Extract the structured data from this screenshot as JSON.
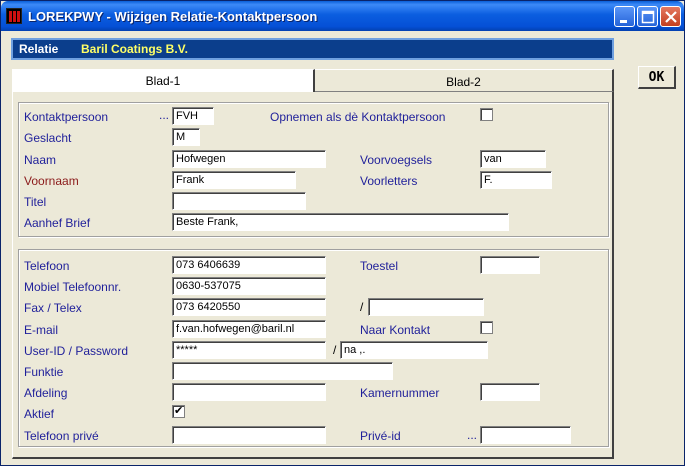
{
  "window": {
    "title": "LOREKPWY - Wijzigen Relatie-Kontaktpersoon",
    "icon": "app-icon",
    "controls": [
      "minimize-icon",
      "maximize-icon",
      "close-icon"
    ]
  },
  "banner": {
    "label": "Relatie",
    "value": "Baril Coatings B.V.",
    "label_color": "#ffffff",
    "value_color": "#ffff66",
    "bg": "#0b3e8c"
  },
  "tabs": [
    {
      "label": "Blad-1",
      "active": true
    },
    {
      "label": "Blad-2",
      "active": false
    }
  ],
  "ok_button": {
    "label": "OK"
  },
  "group1": {
    "kontaktpersoon": {
      "label": "Kontaktpersoon",
      "dots": "...",
      "value": "FVH"
    },
    "opnemen": {
      "label": "Opnemen als dè Kontaktpersoon",
      "checked": false
    },
    "geslacht": {
      "label": "Geslacht",
      "value": "M"
    },
    "naam": {
      "label": "Naam",
      "value": "Hofwegen"
    },
    "voorvoegsels": {
      "label": "Voorvoegsels",
      "value": "van"
    },
    "voornaam": {
      "label": "Voornaam",
      "value": "Frank"
    },
    "voorletters": {
      "label": "Voorletters",
      "value": "F."
    },
    "titel": {
      "label": "Titel",
      "value": ""
    },
    "aanhef": {
      "label": "Aanhef Brief",
      "value": "Beste Frank,"
    }
  },
  "group2": {
    "telefoon": {
      "label": "Telefoon",
      "value": "073 6406639"
    },
    "toestel": {
      "label": "Toestel",
      "value": ""
    },
    "mobiel": {
      "label": "Mobiel Telefoonnr.",
      "value": "0630-537075"
    },
    "fax": {
      "label": "Fax / Telex",
      "value": "073 6420550"
    },
    "fax2": {
      "sep": "/",
      "value": ""
    },
    "email": {
      "label": "E-mail",
      "value": "f.van.hofwegen@baril.nl"
    },
    "naar_kontakt": {
      "label": "Naar Kontakt",
      "checked": false
    },
    "userid": {
      "label": "User-ID / Password",
      "value": "*****",
      "sep": "/",
      "password": "na      ,."
    },
    "funktie": {
      "label": "Funktie",
      "value": ""
    },
    "afdeling": {
      "label": "Afdeling",
      "value": ""
    },
    "kamernummer": {
      "label": "Kamernummer",
      "value": ""
    },
    "aktief": {
      "label": "Aktief",
      "checked": true
    },
    "telefoon_prive": {
      "label": "Telefoon privé",
      "value": ""
    },
    "prive_id": {
      "label": "Privé-id",
      "dots": "...",
      "value": ""
    }
  }
}
